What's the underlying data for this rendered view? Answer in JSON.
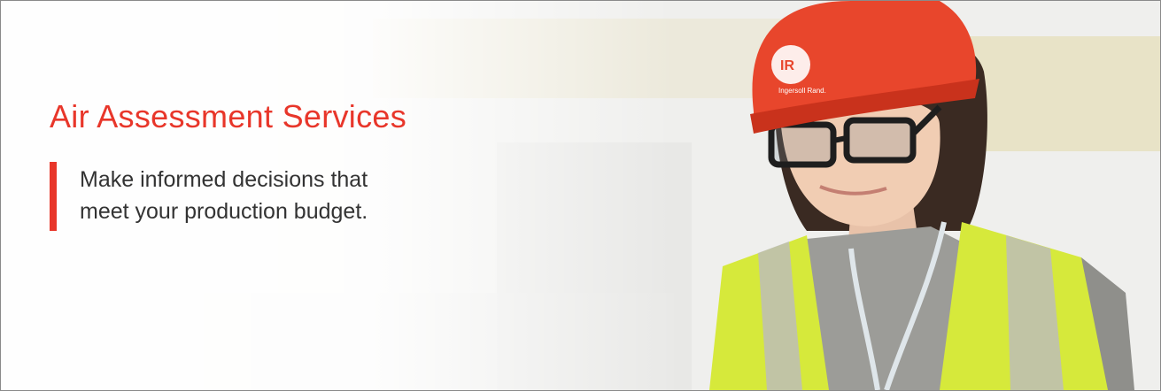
{
  "banner": {
    "title": "Air Assessment Services",
    "subtitle_line1": "Make informed decisions that",
    "subtitle_line2": "meet your production budget.",
    "accent_color": "#e8362a",
    "helmet_logo_text": "IR",
    "helmet_brand_text": "Ingersoll Rand."
  }
}
